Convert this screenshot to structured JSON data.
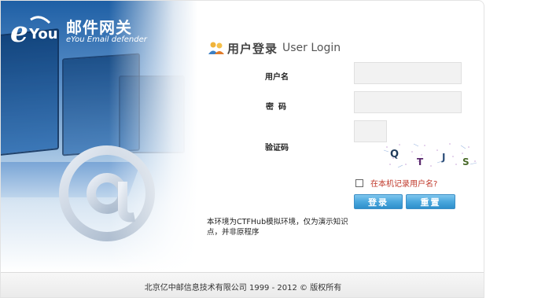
{
  "brand": {
    "logo_text": "eYou",
    "name_cn": "邮件网关",
    "name_en": "eYou Email defender"
  },
  "login": {
    "title_cn": "用户登录",
    "title_en": "User Login",
    "username_label": "用户名",
    "password_label": "密码",
    "captcha_label": "验证码",
    "username_value": "",
    "password_value": "",
    "captcha_value": "",
    "captcha_text": [
      "Q",
      "T",
      "J",
      "S"
    ],
    "remember_label": "在本机记录用户名?",
    "remember_checked": false,
    "login_button": "登录",
    "reset_button": "重置",
    "notice": "本环境为CTFHub模拟环境，仅为演示知识点，并非原程序"
  },
  "footer": {
    "copyright": "北京亿中邮信息技术有限公司    1999 - 2012 © 版权所有"
  },
  "colors": {
    "button": "#3a9ad6",
    "remember_text": "#c0392b",
    "hero_blue": "#1e5fa5"
  }
}
